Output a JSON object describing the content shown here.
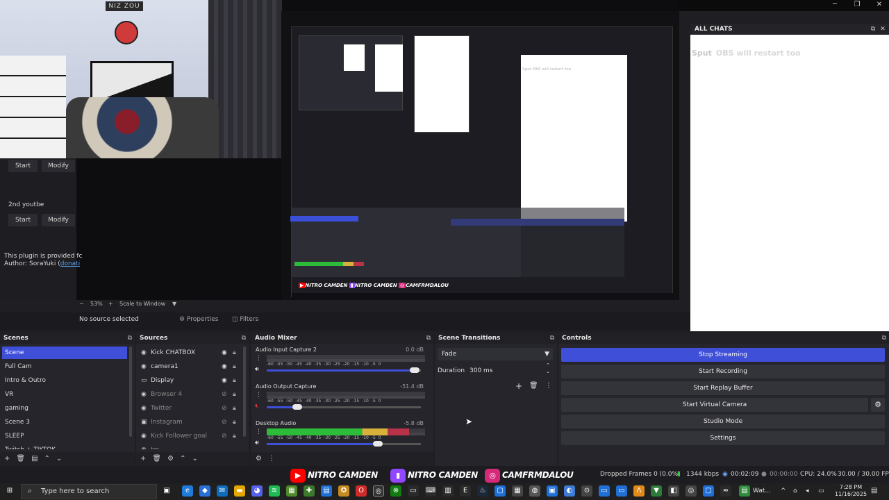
{
  "window": {
    "minimize": "─",
    "restore": "❐",
    "close": "✕"
  },
  "preview": {
    "webcam_sign": "NIZ ZOU",
    "left_panel": {
      "start_label": "Start",
      "modify_label": "Modify",
      "second_item": "2nd youtbe",
      "plugin_text": "This plugin is provided fc",
      "author_text": "Author: SoraYuki (",
      "author_link": "donati"
    },
    "nested_chat_message": "Sput  OBS will restart too",
    "nested_overlay_logos": [
      "NITRO CAMDEN",
      "NITRO CAMDEN",
      "CAMFRMDALOU"
    ]
  },
  "all_chats": {
    "title": "ALL CHATS",
    "messages": [
      {
        "user": "Sput",
        "text": "OBS will restart too"
      }
    ]
  },
  "zoom": {
    "minus": "−",
    "percent": "53%",
    "plus": "+",
    "mode": "Scale to Window"
  },
  "source_toolbar": {
    "no_source": "No source selected",
    "properties": "Properties",
    "filters": "Filters"
  },
  "scenes": {
    "title": "Scenes",
    "items": [
      "Scene",
      "Full Cam",
      "Intro & Outro",
      "VR",
      "gaming",
      "Scene 3",
      "SLEEP",
      "Twitch + TIKTOK"
    ],
    "selected": "Scene"
  },
  "sources": {
    "title": "Sources",
    "items": [
      {
        "name": "Kick CHATBOX",
        "visible": true
      },
      {
        "name": "camera1",
        "visible": true
      },
      {
        "name": "Display",
        "visible": true
      },
      {
        "name": "Browser 4",
        "visible": false
      },
      {
        "name": "Twitter",
        "visible": false
      },
      {
        "name": "Instagram",
        "visible": false
      },
      {
        "name": "Kick Follower goal",
        "visible": false
      },
      {
        "name": "tm",
        "visible": false
      }
    ]
  },
  "audio_mixer": {
    "title": "Audio Mixer",
    "ticks": "-60 -55 -50 -45 -40 -35 -30 -25 -20 -15 -10 -5 0",
    "channels": [
      {
        "name": "Audio Input Capture 2",
        "db": "0.0 dB",
        "level": 0.0,
        "volume": 0.96,
        "muted": false
      },
      {
        "name": "Audio Output Capture",
        "db": "-51.4 dB",
        "level": 0.0,
        "volume": 0.2,
        "muted": true
      },
      {
        "name": "Desktop Audio",
        "db": "-5.8 dB",
        "level": 0.9,
        "volume": 0.72,
        "muted": false
      }
    ]
  },
  "scene_transitions": {
    "title": "Scene Transitions",
    "transition": "Fade",
    "duration_label": "Duration",
    "duration_value": "300 ms"
  },
  "controls": {
    "title": "Controls",
    "buttons": [
      "Stop Streaming",
      "Start Recording",
      "Start Replay Buffer",
      "Start Virtual Camera",
      "Studio Mode",
      "Settings"
    ]
  },
  "overlay_logos": [
    {
      "platform": "youtube-icon",
      "text": "NITRO CAMDEN",
      "color": "#ff0000"
    },
    {
      "platform": "twitch-icon",
      "text": "NITRO CAMDEN",
      "color": "#9146ff"
    },
    {
      "platform": "instagram-icon",
      "text": "CAMFRMDALOU",
      "color": "#d6297a"
    }
  ],
  "status": {
    "dropped_frames": "Dropped Frames 0 (0.0%)",
    "bitrate": "1344 kbps",
    "stream_time": "00:02:09",
    "record_time": "00:00:00",
    "cpu": "CPU: 24.0%",
    "fps": "30.00 / 30.00 FPS"
  },
  "taskbar": {
    "search_placeholder": "Type here to search",
    "weather": "Wat...",
    "time": "7:28 PM",
    "date": "11/16/2025"
  },
  "colors": {
    "accent": "#3f4fd8",
    "panel": "#25252b",
    "background": "#1f1f23",
    "meter_green": "#2dbb3a",
    "meter_yellow": "#d8b13a",
    "meter_red": "#b8324a"
  }
}
